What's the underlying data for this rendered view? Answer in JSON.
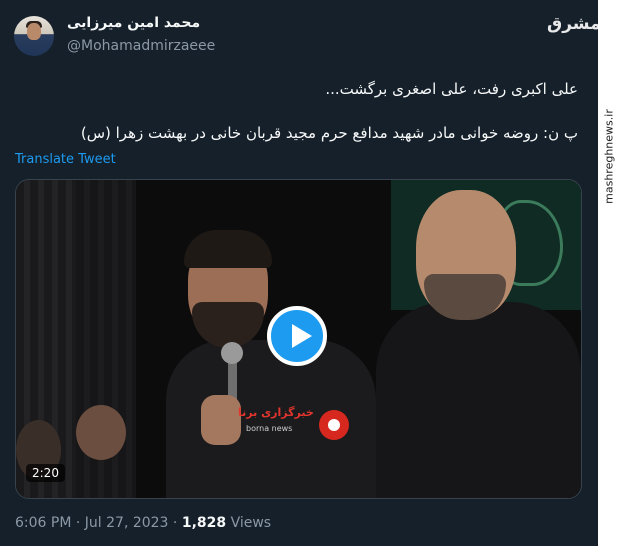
{
  "tweet": {
    "display_name": "محمد امین میرزایی",
    "handle": "@Mohamadmirzaeee",
    "text_line1": "علی اکبری رفت، علی اصغری برگشت...",
    "text_line2": "پ ن: روضه خوانی مادر شهید مدافع حرم مجید قربان خانی در بهشت زهرا (س)",
    "translate_label": "Translate Tweet",
    "video": {
      "duration": "2:20",
      "watermark_text": "خبرگزاری برنا",
      "watermark_sub": "borna news"
    },
    "time": "6:06 PM",
    "separator": "·",
    "date": "Jul 27, 2023",
    "views_count": "1,828",
    "views_label": "Views"
  },
  "side_watermark": {
    "logo_text": "مشرق",
    "url": "mashreghnews.ir"
  },
  "colors": {
    "background": "#15202b",
    "accent": "#1d9bf0",
    "secondary_text": "#8b98a5"
  }
}
